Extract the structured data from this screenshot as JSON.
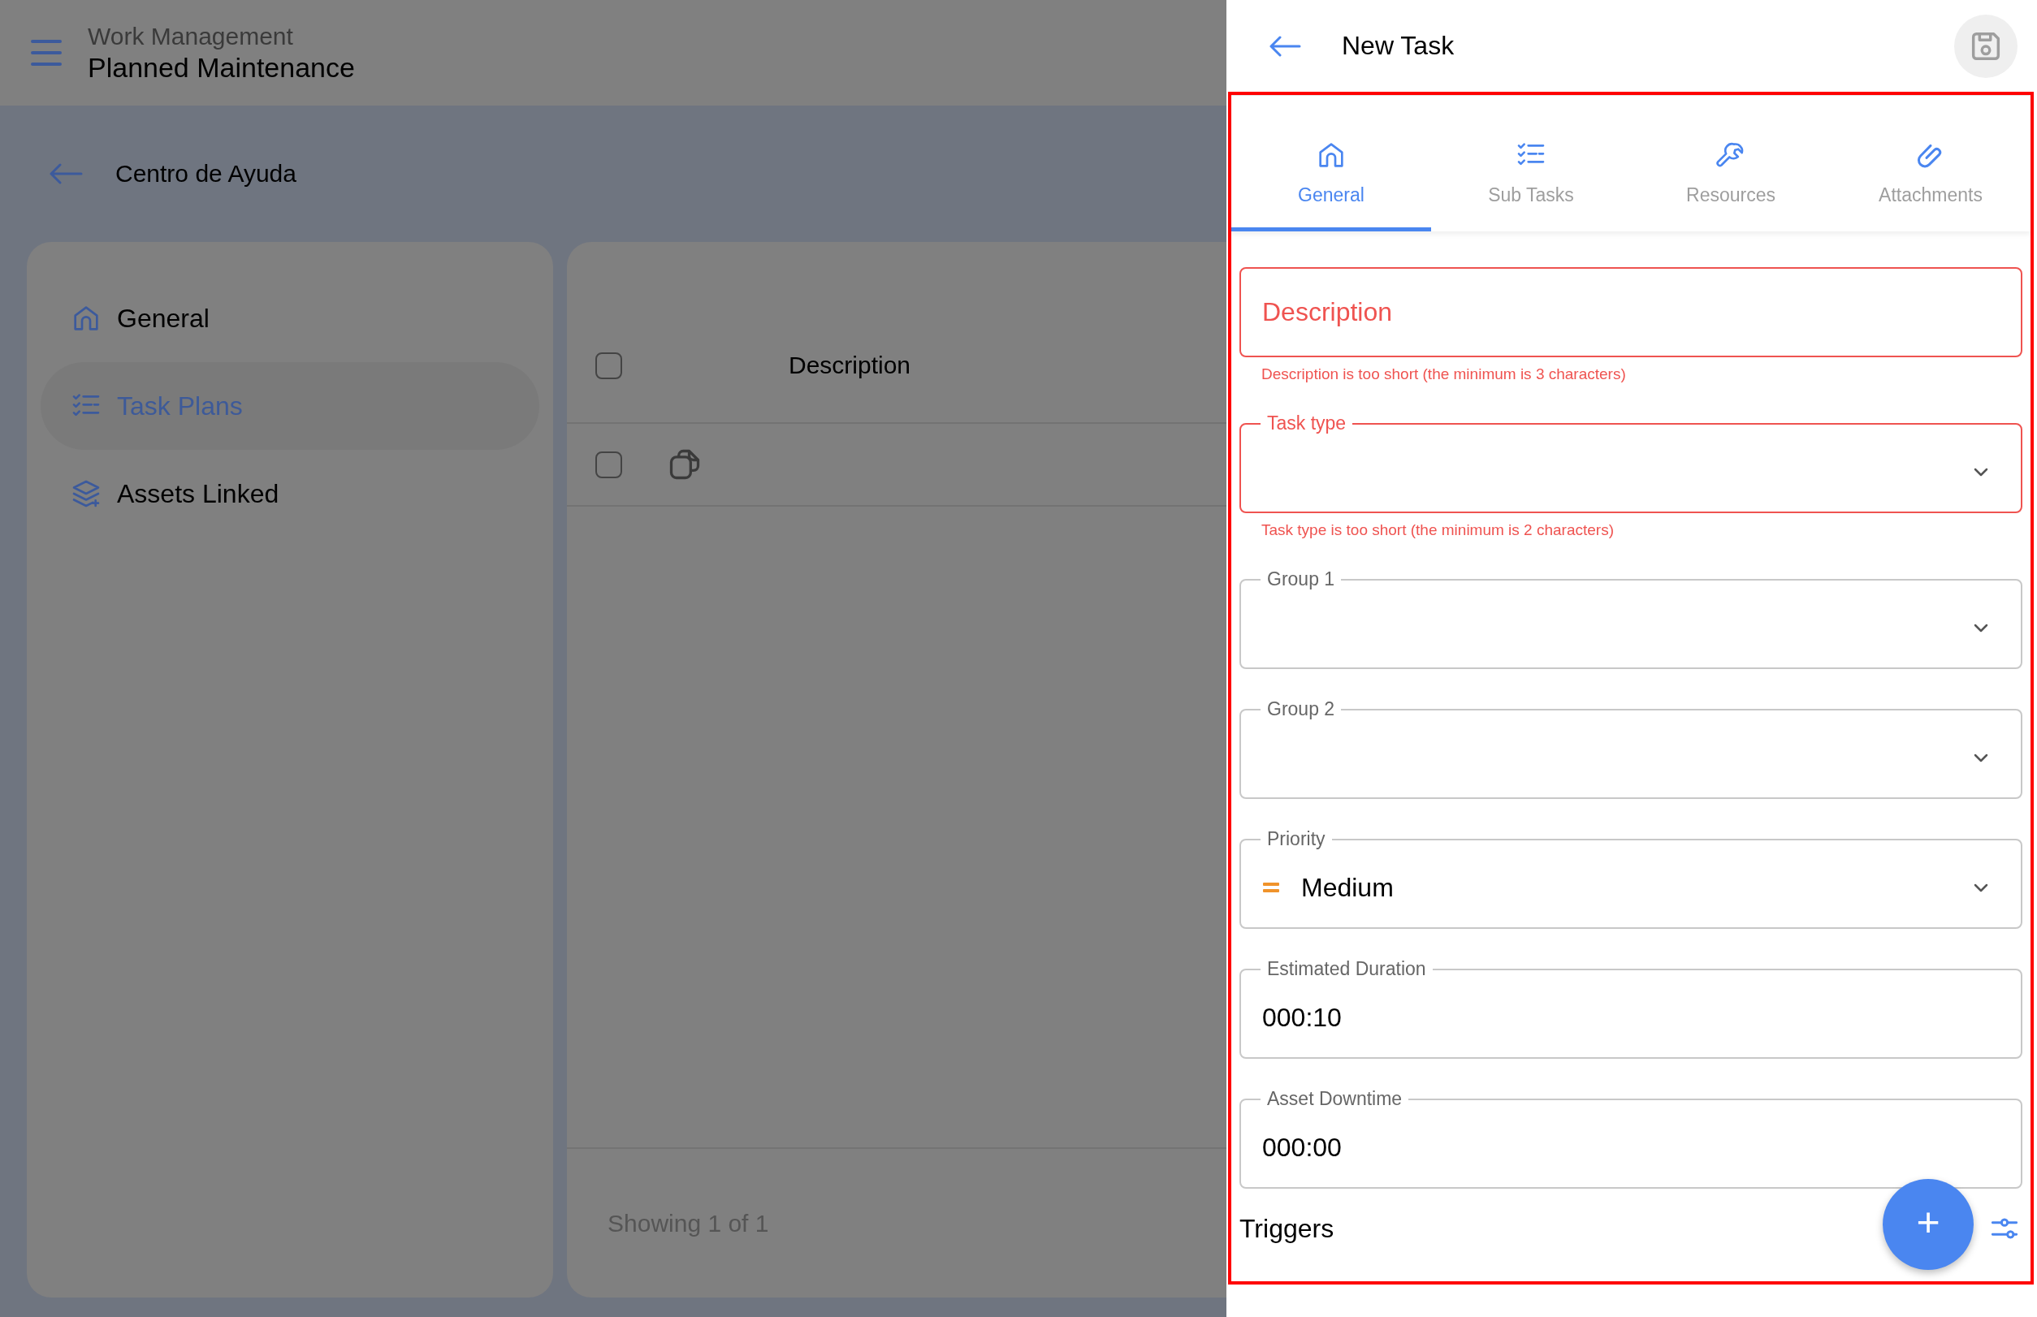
{
  "app_bar": {
    "subtitle": "Work Management",
    "title": "Planned Maintenance"
  },
  "breadcrumb": {
    "label": "Centro de Ayuda"
  },
  "sidebar": {
    "items": [
      {
        "label": "General",
        "kind": "home",
        "selected": false
      },
      {
        "label": "Task Plans",
        "kind": "checklist",
        "selected": true
      },
      {
        "label": "Assets Linked",
        "kind": "layers",
        "selected": false
      }
    ]
  },
  "table": {
    "columns": [
      "Description"
    ],
    "header_checked": false,
    "rows": [
      {
        "checked": false
      }
    ],
    "footer": "Showing 1 of 1"
  },
  "panel": {
    "title": "New Task",
    "tabs": [
      {
        "label": "General",
        "kind": "home",
        "selected": true
      },
      {
        "label": "Sub Tasks",
        "kind": "checklist",
        "selected": false
      },
      {
        "label": "Resources",
        "kind": "wrench",
        "selected": false
      },
      {
        "label": "Attachments",
        "kind": "paperclip",
        "selected": false
      }
    ],
    "fields": [
      {
        "kind": "text",
        "label": "Description",
        "invalid": true,
        "error": "Description is too short (the minimum is 3 characters)"
      },
      {
        "kind": "select",
        "label": "Task type",
        "invalid": true,
        "error": "Task type is too short (the minimum is 2 characters)"
      },
      {
        "kind": "select",
        "label": "Group 1",
        "invalid": false
      },
      {
        "kind": "select",
        "label": "Group 2",
        "invalid": false
      },
      {
        "kind": "priority",
        "label": "Priority",
        "invalid": false,
        "value": "Medium"
      },
      {
        "kind": "text",
        "label": "Estimated Duration",
        "invalid": false,
        "value": "000:10"
      },
      {
        "kind": "text",
        "label": "Asset Downtime",
        "invalid": false,
        "value": "000:00"
      }
    ],
    "section": "Triggers",
    "fab": "+"
  }
}
